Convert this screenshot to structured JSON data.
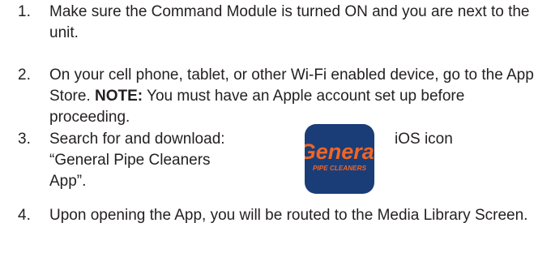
{
  "steps": [
    {
      "number": "1.",
      "text": "Make sure the Command Module is turned ON and you are next to the unit."
    },
    {
      "number": "2.",
      "text_before": "On your cell phone, tablet, or other Wi-Fi enabled device, go to the App Store. ",
      "note_label": "NOTE:",
      "text_after": " You must have an Apple account set up before proceeding."
    },
    {
      "number": "3.",
      "line1": "Search for and download:",
      "line2": "“General Pipe Cleaners App”."
    },
    {
      "number": "4.",
      "text": "Upon opening the App, you will be routed to the Media Library Screen."
    }
  ],
  "app_icon": {
    "brand_word": "General",
    "tagline": "PIPE CLEANERS",
    "background_color": "#1a3d78",
    "text_color": "#f26522",
    "caption": "iOS icon"
  }
}
